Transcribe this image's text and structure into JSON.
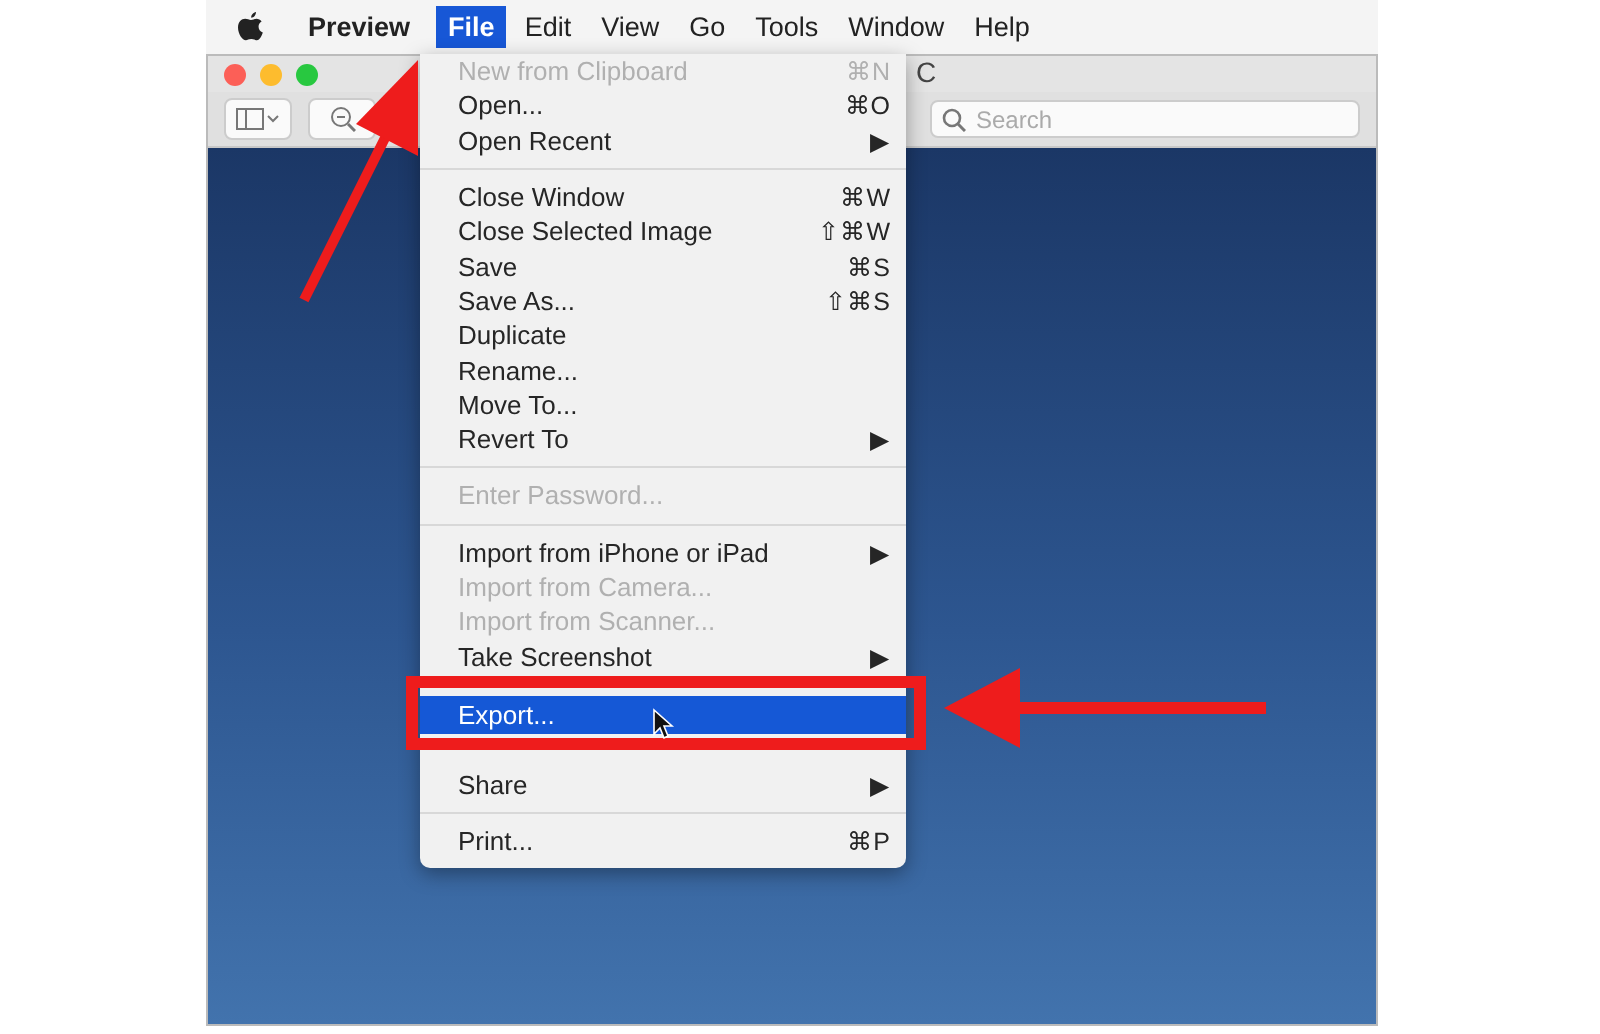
{
  "menu_bar": {
    "app": "Preview",
    "items": [
      {
        "label": "File",
        "selected": true
      },
      {
        "label": "Edit",
        "selected": false
      },
      {
        "label": "View",
        "selected": false
      },
      {
        "label": "Go",
        "selected": false
      },
      {
        "label": "Tools",
        "selected": false
      },
      {
        "label": "Window",
        "selected": false
      },
      {
        "label": "Help",
        "selected": false
      }
    ]
  },
  "window": {
    "title": "C",
    "search": {
      "placeholder": "Search"
    }
  },
  "file_menu": [
    {
      "kind": "item",
      "label": "New from Clipboard",
      "shortcut": "⌘N",
      "disabled": true,
      "selected": false
    },
    {
      "kind": "item",
      "label": "Open...",
      "shortcut": "⌘O",
      "disabled": false,
      "selected": false
    },
    {
      "kind": "submenu",
      "label": "Open Recent",
      "shortcut": "▶",
      "disabled": false,
      "selected": false
    },
    {
      "kind": "separator"
    },
    {
      "kind": "item",
      "label": "Close Window",
      "shortcut": "⌘W",
      "disabled": false,
      "selected": false
    },
    {
      "kind": "item",
      "label": "Close Selected Image",
      "shortcut": "⇧⌘W",
      "disabled": false,
      "selected": false
    },
    {
      "kind": "item",
      "label": "Save",
      "shortcut": "⌘S",
      "disabled": false,
      "selected": false
    },
    {
      "kind": "item",
      "label": "Save As...",
      "shortcut": "⇧⌘S",
      "disabled": false,
      "selected": false
    },
    {
      "kind": "item",
      "label": "Duplicate",
      "disabled": false,
      "selected": false
    },
    {
      "kind": "item",
      "label": "Rename...",
      "disabled": false,
      "selected": false
    },
    {
      "kind": "item",
      "label": "Move To...",
      "disabled": false,
      "selected": false
    },
    {
      "kind": "submenu",
      "label": "Revert To",
      "shortcut": "▶",
      "disabled": false,
      "selected": false
    },
    {
      "kind": "separator"
    },
    {
      "kind": "item",
      "label": "Enter Password...",
      "disabled": true,
      "selected": false
    },
    {
      "kind": "separator"
    },
    {
      "kind": "submenu",
      "label": "Import from iPhone or iPad",
      "shortcut": "▶",
      "disabled": false,
      "selected": false
    },
    {
      "kind": "item",
      "label": "Import from Camera...",
      "disabled": true,
      "selected": false
    },
    {
      "kind": "item",
      "label": "Import from Scanner...",
      "disabled": true,
      "selected": false
    },
    {
      "kind": "submenu",
      "label": "Take Screenshot",
      "shortcut": "▶",
      "disabled": false,
      "selected": false
    },
    {
      "kind": "separator"
    },
    {
      "kind": "item",
      "label": "Export...",
      "disabled": false,
      "selected": true
    },
    {
      "kind": "covered"
    },
    {
      "kind": "submenu",
      "label": "Share",
      "shortcut": "▶",
      "disabled": false,
      "selected": false
    },
    {
      "kind": "separator"
    },
    {
      "kind": "item",
      "label": "Print...",
      "shortcut": "⌘P",
      "disabled": false,
      "selected": false
    }
  ]
}
